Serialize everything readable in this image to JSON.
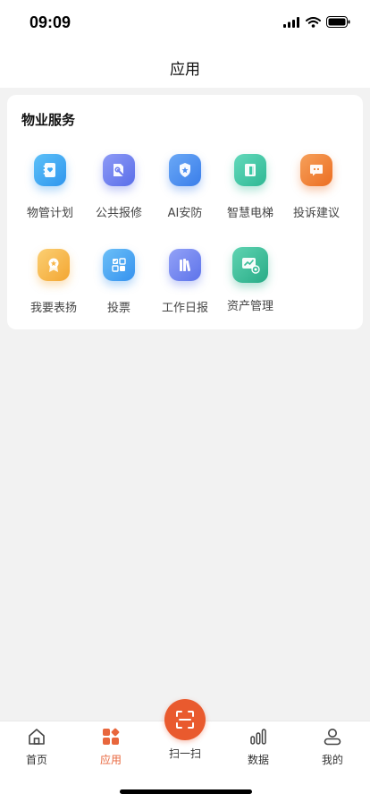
{
  "status_bar": {
    "time": "09:09"
  },
  "nav": {
    "title": "应用"
  },
  "property_services": {
    "title": "物业服务",
    "items": [
      {
        "label": "物管计划",
        "icon": "notebook-icon",
        "color": "#3aa6f3"
      },
      {
        "label": "公共报修",
        "icon": "wrench-icon",
        "color": "#6f7ef0"
      },
      {
        "label": "AI安防",
        "icon": "shield-icon",
        "color": "#4d8ef0"
      },
      {
        "label": "智慧电梯",
        "icon": "elevator-icon",
        "color": "#3dc9a6"
      },
      {
        "label": "投诉建议",
        "icon": "chat-icon",
        "color": "#f08232"
      },
      {
        "label": "我要表扬",
        "icon": "medal-icon",
        "color": "#f7b64b"
      },
      {
        "label": "投票",
        "icon": "ballot-icon",
        "color": "#43a8f2"
      },
      {
        "label": "工作日报",
        "icon": "books-icon",
        "color": "#6c82f0"
      },
      {
        "label": "资产管理",
        "icon": "chart-icon",
        "color": "#3cbe9a"
      }
    ]
  },
  "tab_bar": {
    "home": "首页",
    "apps": "应用",
    "scan": "扫一扫",
    "data": "数据",
    "mine": "我的"
  },
  "colors": {
    "accent": "#e95a2e",
    "active_tab": "#e8663c"
  }
}
